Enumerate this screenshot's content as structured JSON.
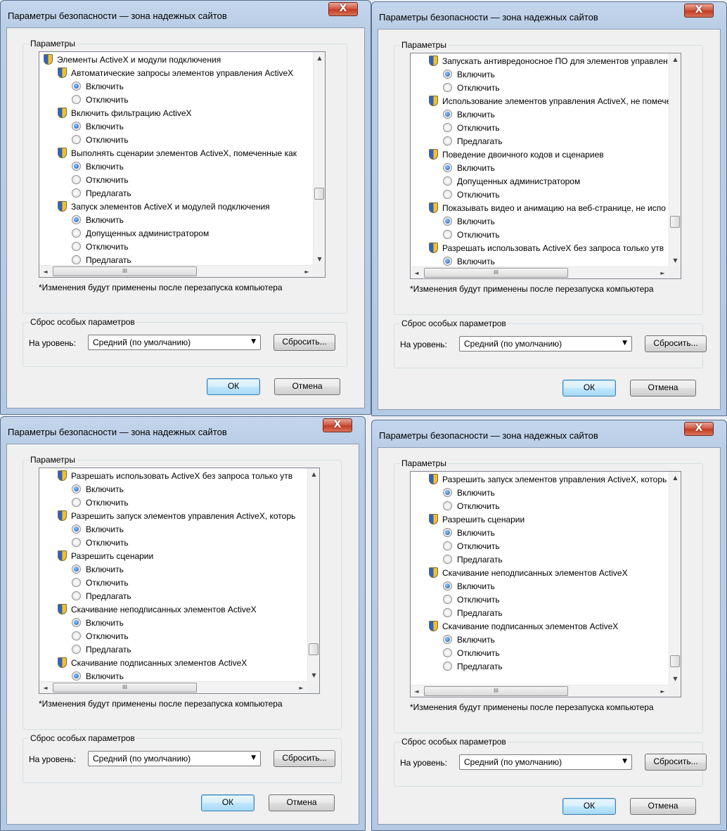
{
  "dialogs": [
    {
      "title": "Параметры безопасности — зона надежных сайтов",
      "close_label": "X",
      "params_label": "Параметры",
      "rows": [
        {
          "kind": "cat",
          "text": "Элементы ActiveX и модули подключения"
        },
        {
          "kind": "setting",
          "text": "Автоматические запросы элементов управления ActiveX"
        },
        {
          "kind": "opt",
          "text": "Включить",
          "checked": true
        },
        {
          "kind": "opt",
          "text": "Отключить",
          "checked": false
        },
        {
          "kind": "setting",
          "text": "Включить фильтрацию ActiveX"
        },
        {
          "kind": "opt",
          "text": "Включить",
          "checked": true
        },
        {
          "kind": "opt",
          "text": "Отключить",
          "checked": false
        },
        {
          "kind": "setting",
          "text": "Выполнять сценарии элементов ActiveX, помеченные как"
        },
        {
          "kind": "opt",
          "text": "Включить",
          "checked": true
        },
        {
          "kind": "opt",
          "text": "Отключить",
          "checked": false
        },
        {
          "kind": "opt",
          "text": "Предлагать",
          "checked": false
        },
        {
          "kind": "setting",
          "text": "Запуск элементов ActiveX и модулей подключения"
        },
        {
          "kind": "opt",
          "text": "Включить",
          "checked": true
        },
        {
          "kind": "opt",
          "text": "Допущенных администратором",
          "checked": false
        },
        {
          "kind": "opt",
          "text": "Отключить",
          "checked": false
        },
        {
          "kind": "opt",
          "text": "Предлагать",
          "checked": false
        }
      ],
      "scroll_pos": 0.7,
      "note": "*Изменения будут применены после перезапуска компьютера",
      "reset_group_label": "Сброс особых параметров",
      "level_label": "На уровень:",
      "level_value": "Средний (по умолчанию)",
      "reset_button": "Сбросить...",
      "ok_button": "ОК",
      "cancel_button": "Отмена"
    },
    {
      "title": "Параметры безопасности — зона надежных сайтов",
      "close_label": "X",
      "params_label": "Параметры",
      "rows": [
        {
          "kind": "setting",
          "text": "Запускать антивредоносное ПО для элементов управлен"
        },
        {
          "kind": "opt",
          "text": "Включить",
          "checked": true
        },
        {
          "kind": "opt",
          "text": "Отключить",
          "checked": false
        },
        {
          "kind": "setting",
          "text": "Использование элементов управления ActiveX, не помече"
        },
        {
          "kind": "opt",
          "text": "Включить",
          "checked": true
        },
        {
          "kind": "opt",
          "text": "Отключить",
          "checked": false
        },
        {
          "kind": "opt",
          "text": "Предлагать",
          "checked": false
        },
        {
          "kind": "setting",
          "text": "Поведение двоичного кодов и сценариев"
        },
        {
          "kind": "opt",
          "text": "Включить",
          "checked": true
        },
        {
          "kind": "opt",
          "text": "Допущенных администратором",
          "checked": false
        },
        {
          "kind": "opt",
          "text": "Отключить",
          "checked": false
        },
        {
          "kind": "setting",
          "text": "Показывать видео и анимацию на веб-странице, не испо"
        },
        {
          "kind": "opt",
          "text": "Включить",
          "checked": true
        },
        {
          "kind": "opt",
          "text": "Отключить",
          "checked": false
        },
        {
          "kind": "setting",
          "text": "Разрешать использовать ActiveX без запроса только утв"
        },
        {
          "kind": "opt",
          "text": "Включить",
          "checked": true
        }
      ],
      "scroll_pos": 0.85,
      "note": "*Изменения будут применены после перезапуска компьютера",
      "reset_group_label": "Сброс особых параметров",
      "level_label": "На уровень:",
      "level_value": "Средний (по умолчанию)",
      "reset_button": "Сбросить...",
      "ok_button": "ОК",
      "cancel_button": "Отмена"
    },
    {
      "title": "Параметры безопасности — зона надежных сайтов",
      "close_label": "X",
      "params_label": "Параметры",
      "rows": [
        {
          "kind": "setting",
          "text": "Разрешать использовать ActiveX без запроса только утв"
        },
        {
          "kind": "opt",
          "text": "Включить",
          "checked": true
        },
        {
          "kind": "opt",
          "text": "Отключить",
          "checked": false
        },
        {
          "kind": "setting",
          "text": "Разрешить запуск элементов управления ActiveX, которь"
        },
        {
          "kind": "opt",
          "text": "Включить",
          "checked": true
        },
        {
          "kind": "opt",
          "text": "Отключить",
          "checked": false
        },
        {
          "kind": "setting",
          "text": "Разрешить сценарии"
        },
        {
          "kind": "opt",
          "text": "Включить",
          "checked": true
        },
        {
          "kind": "opt",
          "text": "Отключить",
          "checked": false
        },
        {
          "kind": "opt",
          "text": "Предлагать",
          "checked": false
        },
        {
          "kind": "setting",
          "text": "Скачивание неподписанных элементов ActiveX"
        },
        {
          "kind": "opt",
          "text": "Включить",
          "checked": true
        },
        {
          "kind": "opt",
          "text": "Отключить",
          "checked": false
        },
        {
          "kind": "opt",
          "text": "Предлагать",
          "checked": false
        },
        {
          "kind": "setting",
          "text": "Скачивание подписанных элементов ActiveX"
        },
        {
          "kind": "opt",
          "text": "Включить",
          "checked": true
        }
      ],
      "scroll_pos": 0.92,
      "note": "*Изменения будут применены после перезапуска компьютера",
      "reset_group_label": "Сброс особых параметров",
      "level_label": "На уровень:",
      "level_value": "Средний (по умолчанию)",
      "reset_button": "Сбросить...",
      "ok_button": "ОК",
      "cancel_button": "Отмена"
    },
    {
      "title": "Параметры безопасности — зона надежных сайтов",
      "close_label": "X",
      "params_label": "Параметры",
      "rows": [
        {
          "kind": "setting",
          "text": "Разрешить запуск элементов управления ActiveX, которь"
        },
        {
          "kind": "opt",
          "text": "Включить",
          "checked": true
        },
        {
          "kind": "opt",
          "text": "Отключить",
          "checked": false
        },
        {
          "kind": "setting",
          "text": "Разрешить сценарии"
        },
        {
          "kind": "opt",
          "text": "Включить",
          "checked": true
        },
        {
          "kind": "opt",
          "text": "Отключить",
          "checked": false
        },
        {
          "kind": "opt",
          "text": "Предлагать",
          "checked": false
        },
        {
          "kind": "setting",
          "text": "Скачивание неподписанных элементов ActiveX"
        },
        {
          "kind": "opt",
          "text": "Включить",
          "checked": true
        },
        {
          "kind": "opt",
          "text": "Отключить",
          "checked": false
        },
        {
          "kind": "opt",
          "text": "Предлагать",
          "checked": false
        },
        {
          "kind": "setting",
          "text": "Скачивание подписанных элементов ActiveX"
        },
        {
          "kind": "opt",
          "text": "Включить",
          "checked": true
        },
        {
          "kind": "opt",
          "text": "Отключить",
          "checked": false
        },
        {
          "kind": "opt",
          "text": "Предлагать",
          "checked": false
        }
      ],
      "scroll_pos": 0.97,
      "note": "*Изменения будут применены после перезапуска компьютера",
      "reset_group_label": "Сброс особых параметров",
      "level_label": "На уровень:",
      "level_value": "Средний (по умолчанию)",
      "reset_button": "Сбросить...",
      "ok_button": "ОК",
      "cancel_button": "Отмена"
    }
  ],
  "scroll_arrows": {
    "up": "▲",
    "down": "▼",
    "left": "◄",
    "right": "►",
    "grip": "III"
  }
}
